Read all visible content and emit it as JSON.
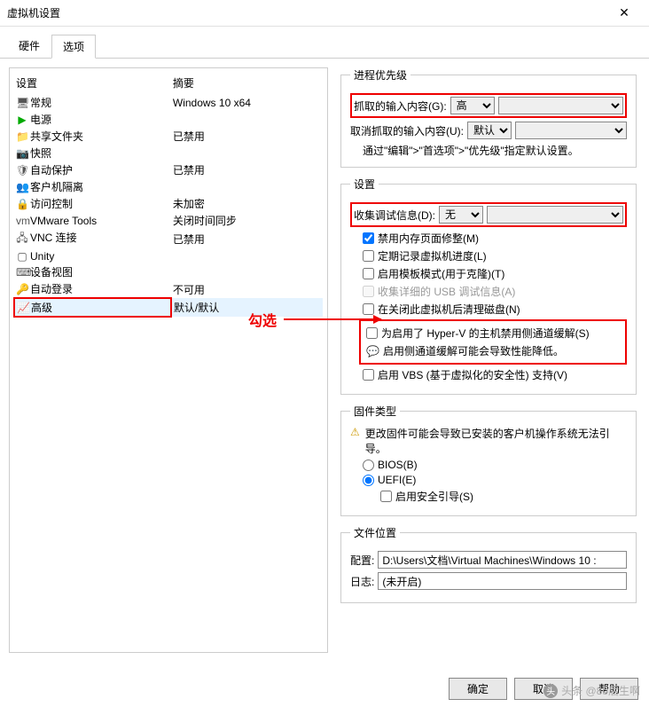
{
  "window": {
    "title": "虚拟机设置",
    "close": "✕"
  },
  "tabs": {
    "hardware": "硬件",
    "options": "选项"
  },
  "list": {
    "col_setting": "设置",
    "col_summary": "摘要",
    "items": [
      {
        "icon": "🖥",
        "name": "常规",
        "summary": "Windows 10 x64"
      },
      {
        "icon": "▶",
        "iconClass": "green",
        "name": "电源",
        "summary": ""
      },
      {
        "icon": "📁",
        "name": "共享文件夹",
        "summary": "已禁用"
      },
      {
        "icon": "📷",
        "name": "快照",
        "summary": ""
      },
      {
        "icon": "🛡",
        "name": "自动保护",
        "summary": "已禁用"
      },
      {
        "icon": "👥",
        "name": "客户机隔离",
        "summary": ""
      },
      {
        "icon": "🔒",
        "name": "访问控制",
        "summary": "未加密"
      },
      {
        "icon": "vm",
        "name": "VMware Tools",
        "summary": "关闭时间同步"
      },
      {
        "icon": "🖧",
        "name": "VNC 连接",
        "summary": "已禁用"
      },
      {
        "icon": "▢",
        "name": "Unity",
        "summary": ""
      },
      {
        "icon": "⌨",
        "name": "设备视图",
        "summary": ""
      },
      {
        "icon": "🔑",
        "name": "自动登录",
        "summary": "不可用"
      },
      {
        "icon": "📈",
        "name": "高级",
        "summary": "默认/默认"
      }
    ]
  },
  "priority": {
    "legend": "进程优先级",
    "grabbed_label": "抓取的输入内容(G):",
    "grabbed_value": "高",
    "ungrabbed_label": "取消抓取的输入内容(U):",
    "ungrabbed_value": "默认",
    "note": "通过\"编辑\">\"首选项\">\"优先级\"指定默认设置。"
  },
  "settings": {
    "legend": "设置",
    "debug_label": "收集调试信息(D):",
    "debug_value": "无",
    "mem_trim": "禁用内存页面修整(M)",
    "log_progress": "定期记录虚拟机进度(L)",
    "template_mode": "启用模板模式(用于克隆)(T)",
    "usb_debug": "收集详细的 USB 调试信息(A)",
    "cleanup_disk": "在关闭此虚拟机后清理磁盘(N)",
    "hyperv_disable": "为启用了 Hyper-V 的主机禁用侧通道缓解(S)",
    "hyperv_note": "启用侧通道缓解可能会导致性能降低。",
    "vbs": "启用 VBS (基于虚拟化的安全性) 支持(V)"
  },
  "firmware": {
    "legend": "固件类型",
    "warn": "更改固件可能会导致已安装的客户机操作系统无法引导。",
    "bios": "BIOS(B)",
    "uefi": "UEFI(E)",
    "secure_boot": "启用安全引导(S)"
  },
  "fileloc": {
    "legend": "文件位置",
    "config_label": "配置:",
    "config_value": "D:\\Users\\文档\\Virtual Machines\\Windows 10 :",
    "log_label": "日志:",
    "log_value": "(未开启)"
  },
  "buttons": {
    "ok": "确定",
    "cancel": "取消",
    "help": "帮助"
  },
  "annotation": "勾选",
  "watermark": "头条 @80后生啊"
}
